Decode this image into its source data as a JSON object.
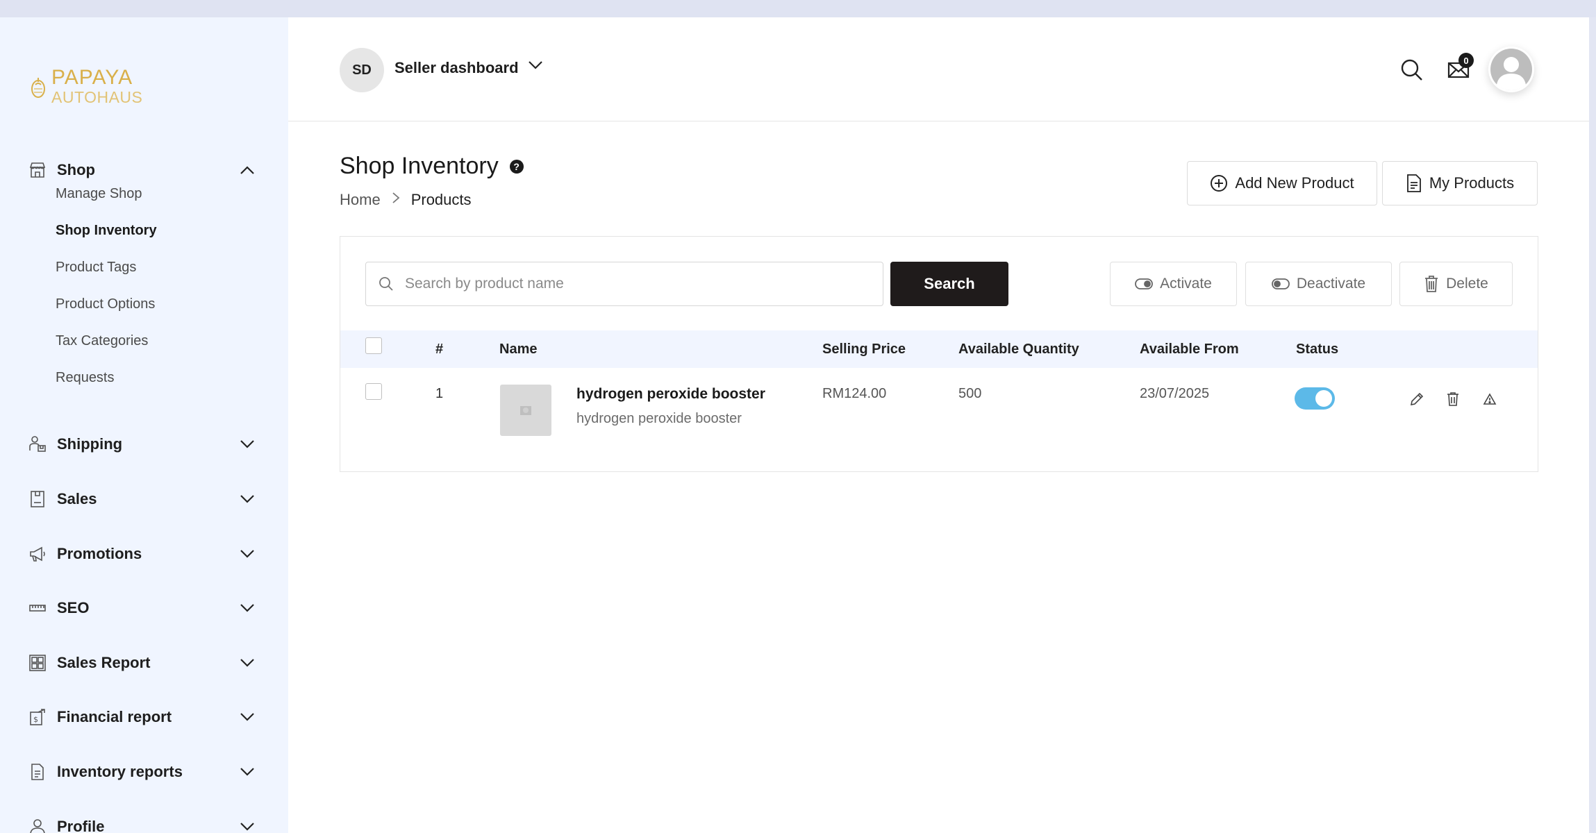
{
  "brand": {
    "line1": "PAPAYA",
    "line2": "AUTOHAUS"
  },
  "sidebar": {
    "groups": [
      {
        "label": "Shop",
        "icon": "store-icon",
        "expanded": true
      },
      {
        "label": "Shipping",
        "icon": "shipping-icon"
      },
      {
        "label": "Sales",
        "icon": "sales-icon"
      },
      {
        "label": "Promotions",
        "icon": "megaphone-icon"
      },
      {
        "label": "SEO",
        "icon": "seo-icon"
      },
      {
        "label": "Sales Report",
        "icon": "report-grid-icon"
      },
      {
        "label": "Financial report",
        "icon": "financial-icon"
      },
      {
        "label": "Inventory reports",
        "icon": "inventory-doc-icon"
      },
      {
        "label": "Profile",
        "icon": "user-icon"
      }
    ],
    "shop_items": [
      "Manage Shop",
      "Shop Inventory",
      "Product Tags",
      "Product Options",
      "Tax Categories",
      "Requests"
    ],
    "active_item": "Shop Inventory"
  },
  "header": {
    "avatar_initials": "SD",
    "dashboard_label": "Seller dashboard",
    "mail_count": "0"
  },
  "page": {
    "title": "Shop Inventory",
    "breadcrumb": [
      "Home",
      "Products"
    ],
    "add_button": "Add New Product",
    "my_products_button": "My Products"
  },
  "toolbar": {
    "search_placeholder": "Search by product name",
    "search_button": "Search",
    "activate": "Activate",
    "deactivate": "Deactivate",
    "delete": "Delete"
  },
  "table": {
    "columns": [
      "#",
      "Name",
      "Selling Price",
      "Available Quantity",
      "Available From",
      "Status"
    ],
    "rows": [
      {
        "index": "1",
        "name": "hydrogen peroxide booster",
        "subtitle": "hydrogen peroxide booster",
        "price": "RM124.00",
        "quantity": "500",
        "available_from": "23/07/2025",
        "active": true
      }
    ]
  },
  "colors": {
    "accent_toggle": "#5cb9e8",
    "brand_gold": "#d9b04a",
    "primary_dark": "#1f1b1b",
    "sidebar_bg": "#f0f5ff"
  }
}
